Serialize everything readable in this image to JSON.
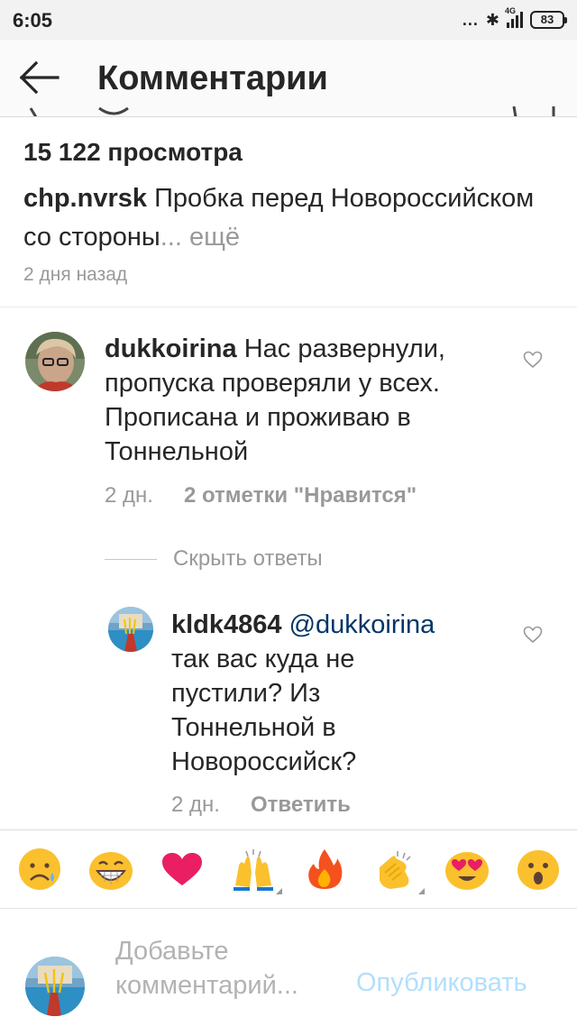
{
  "status_bar": {
    "time": "6:05",
    "dots": "...",
    "network": "4G",
    "battery": "83"
  },
  "header": {
    "title": "Комментарии",
    "back_icon": "arrow-left-icon"
  },
  "post": {
    "views": "15 122 просмотра",
    "username": "chp.nvrsk",
    "caption": "Пробка перед Новороссийском со стороны",
    "more": "... ещё",
    "time": "2 дня назад"
  },
  "comments": [
    {
      "username": "dukkoirina",
      "text": "Нас развернули, пропуска проверяли у всех. Прописана и проживаю в Тоннельной",
      "time": "2 дн.",
      "likes": "2 отметки \"Нравится\"",
      "hide_replies": "Скрыть ответы",
      "replies": [
        {
          "username": "kldk4864",
          "mention": "@dukkoirina",
          "text": "так вас куда не пустили? Из Тоннельной в Новороссийск?",
          "time": "2 дн.",
          "reply": "Ответить"
        }
      ]
    }
  ],
  "emoji_bar": [
    "sad-face-emoji",
    "grin-emoji",
    "heart-emoji",
    "raised-hands-emoji",
    "fire-emoji",
    "clapping-hands-emoji",
    "heart-eyes-emoji",
    "surprised-face-emoji"
  ],
  "compose": {
    "placeholder": "Добавьте комментарий...",
    "publish": "Опубликовать"
  },
  "colors": {
    "link_blue": "#003569",
    "publish_disabled": "#b2dffc",
    "secondary_text": "#999999"
  }
}
